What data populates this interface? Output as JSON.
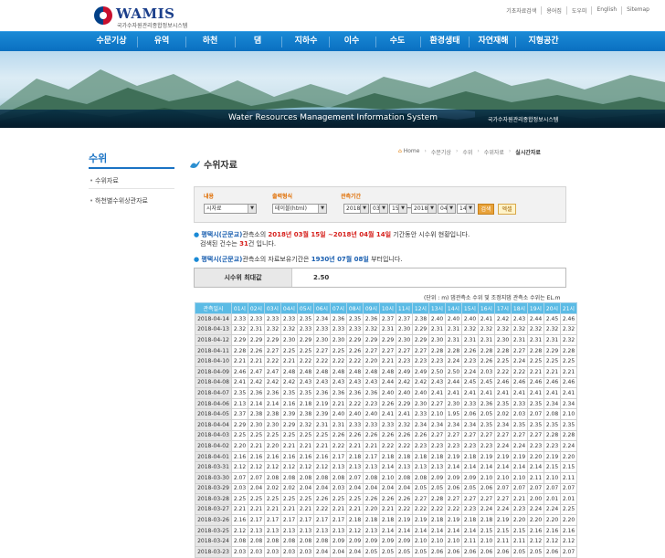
{
  "header": {
    "logo_name": "WAMIS",
    "logo_sub": "국가수자원관리종합정보시스템",
    "util_links": [
      "기초자료검색",
      "용어집",
      "도우미",
      "English",
      "Sitemap"
    ]
  },
  "gnb": [
    "수문기상",
    "유역",
    "하천",
    "댐",
    "지하수",
    "이수",
    "수도",
    "환경생태",
    "자연재해",
    "지형공간"
  ],
  "banner": {
    "title_en": "Water Resources Management Information System",
    "title_ko": "국가수자원관리종합정보시스템"
  },
  "lnb": {
    "title": "수위",
    "items": [
      "수위자료",
      "하천별수위상관자료"
    ]
  },
  "breadcrumb": [
    "Home",
    "수문기상",
    "수위",
    "수위자료",
    "실시간자료"
  ],
  "page_title": "수위자료",
  "search": {
    "label_type": "내용",
    "label_format": "출력형식",
    "label_period": "관측기간",
    "type_value": "시자료",
    "format_value": "테이블(html)",
    "start_year": "2018",
    "start_month": "03",
    "start_day": "15",
    "end_year": "2018",
    "end_month": "04",
    "end_day": "14",
    "search_button": "검색",
    "excel_button": "엑셀"
  },
  "notice1": {
    "station": "평택시(군문교)",
    "p1": "관측소의",
    "period": "2018년 03월 15일 ~2018년 04월 14일",
    "p2": "기간동안 시수위 현황입니다.",
    "p3": "검색된 건수는",
    "count": "31",
    "p4": "건 입니다."
  },
  "notice2": {
    "station": "평택시(군문교)",
    "p1": "관측소의 자료보유기간은",
    "since": "1930년 07월 08일",
    "p2": "부터입니다."
  },
  "max_level": {
    "label": "시수위 최대값",
    "value": "2.50"
  },
  "unit_note": "(단위 : m)  댐관측소 수위 및 조정지댐 관측소 수위는 EL.m",
  "table": {
    "headers": [
      "관측일시",
      "01시",
      "02시",
      "03시",
      "04시",
      "05시",
      "06시",
      "07시",
      "08시",
      "09시",
      "10시",
      "11시",
      "12시",
      "13시",
      "14시",
      "15시",
      "16시",
      "17시",
      "18시",
      "19시",
      "20시",
      "21시"
    ],
    "rows": [
      [
        "2018-04-14",
        "2.33",
        "2.33",
        "2.33",
        "2.33",
        "2.35",
        "2.34",
        "2.36",
        "2.35",
        "2.36",
        "2.37",
        "2.37",
        "2.38",
        "2.40",
        "2.40",
        "2.40",
        "2.41",
        "2.42",
        "2.43",
        "2.44",
        "2.45",
        "2.46"
      ],
      [
        "2018-04-13",
        "2.32",
        "2.31",
        "2.32",
        "2.32",
        "2.33",
        "2.33",
        "2.33",
        "2.33",
        "2.32",
        "2.31",
        "2.30",
        "2.29",
        "2.31",
        "2.31",
        "2.32",
        "2.32",
        "2.32",
        "2.32",
        "2.32",
        "2.32",
        "2.32"
      ],
      [
        "2018-04-12",
        "2.29",
        "2.29",
        "2.29",
        "2.30",
        "2.29",
        "2.30",
        "2.30",
        "2.29",
        "2.29",
        "2.29",
        "2.30",
        "2.29",
        "2.30",
        "2.31",
        "2.31",
        "2.31",
        "2.30",
        "2.31",
        "2.31",
        "2.31",
        "2.32"
      ],
      [
        "2018-04-11",
        "2.28",
        "2.26",
        "2.27",
        "2.25",
        "2.25",
        "2.27",
        "2.25",
        "2.26",
        "2.27",
        "2.27",
        "2.27",
        "2.27",
        "2.28",
        "2.28",
        "2.26",
        "2.28",
        "2.28",
        "2.27",
        "2.28",
        "2.29",
        "2.28"
      ],
      [
        "2018-04-10",
        "2.21",
        "2.21",
        "2.22",
        "2.21",
        "2.22",
        "2.22",
        "2.22",
        "2.22",
        "2.20",
        "2.21",
        "2.23",
        "2.23",
        "2.23",
        "2.24",
        "2.23",
        "2.26",
        "2.25",
        "2.24",
        "2.25",
        "2.25",
        "2.25"
      ],
      [
        "2018-04-09",
        "2.46",
        "2.47",
        "2.47",
        "2.48",
        "2.48",
        "2.48",
        "2.48",
        "2.48",
        "2.48",
        "2.48",
        "2.49",
        "2.49",
        "2.50",
        "2.50",
        "2.24",
        "2.03",
        "2.22",
        "2.22",
        "2.21",
        "2.21",
        "2.21"
      ],
      [
        "2018-04-08",
        "2.41",
        "2.42",
        "2.42",
        "2.42",
        "2.43",
        "2.43",
        "2.43",
        "2.43",
        "2.43",
        "2.44",
        "2.42",
        "2.42",
        "2.43",
        "2.44",
        "2.45",
        "2.45",
        "2.46",
        "2.46",
        "2.46",
        "2.46",
        "2.46"
      ],
      [
        "2018-04-07",
        "2.35",
        "2.36",
        "2.36",
        "2.35",
        "2.35",
        "2.36",
        "2.36",
        "2.36",
        "2.36",
        "2.40",
        "2.40",
        "2.40",
        "2.41",
        "2.41",
        "2.41",
        "2.41",
        "2.41",
        "2.41",
        "2.41",
        "2.41",
        "2.41"
      ],
      [
        "2018-04-06",
        "2.13",
        "2.14",
        "2.14",
        "2.16",
        "2.18",
        "2.19",
        "2.21",
        "2.22",
        "2.23",
        "2.26",
        "2.29",
        "2.30",
        "2.27",
        "2.30",
        "2.33",
        "2.36",
        "2.35",
        "2.33",
        "2.35",
        "2.34",
        "2.34"
      ],
      [
        "2018-04-05",
        "2.37",
        "2.38",
        "2.38",
        "2.39",
        "2.38",
        "2.39",
        "2.40",
        "2.40",
        "2.40",
        "2.41",
        "2.41",
        "2.33",
        "2.10",
        "1.95",
        "2.06",
        "2.05",
        "2.02",
        "2.03",
        "2.07",
        "2.08",
        "2.10"
      ],
      [
        "2018-04-04",
        "2.29",
        "2.30",
        "2.30",
        "2.29",
        "2.32",
        "2.31",
        "2.31",
        "2.33",
        "2.33",
        "2.33",
        "2.32",
        "2.34",
        "2.34",
        "2.34",
        "2.34",
        "2.35",
        "2.34",
        "2.35",
        "2.35",
        "2.35",
        "2.35"
      ],
      [
        "2018-04-03",
        "2.25",
        "2.25",
        "2.25",
        "2.25",
        "2.25",
        "2.25",
        "2.26",
        "2.26",
        "2.26",
        "2.26",
        "2.26",
        "2.26",
        "2.27",
        "2.27",
        "2.27",
        "2.27",
        "2.27",
        "2.27",
        "2.27",
        "2.28",
        "2.28"
      ],
      [
        "2018-04-02",
        "2.20",
        "2.21",
        "2.20",
        "2.21",
        "2.21",
        "2.21",
        "2.22",
        "2.21",
        "2.21",
        "2.22",
        "2.22",
        "2.23",
        "2.23",
        "2.23",
        "2.23",
        "2.23",
        "2.24",
        "2.24",
        "2.23",
        "2.23",
        "2.24"
      ],
      [
        "2018-04-01",
        "2.16",
        "2.16",
        "2.16",
        "2.16",
        "2.16",
        "2.16",
        "2.17",
        "2.18",
        "2.17",
        "2.18",
        "2.18",
        "2.18",
        "2.18",
        "2.19",
        "2.18",
        "2.19",
        "2.19",
        "2.19",
        "2.20",
        "2.19",
        "2.20"
      ],
      [
        "2018-03-31",
        "2.12",
        "2.12",
        "2.12",
        "2.12",
        "2.12",
        "2.12",
        "2.13",
        "2.13",
        "2.13",
        "2.14",
        "2.13",
        "2.13",
        "2.13",
        "2.14",
        "2.14",
        "2.14",
        "2.14",
        "2.14",
        "2.14",
        "2.15",
        "2.15"
      ],
      [
        "2018-03-30",
        "2.07",
        "2.07",
        "2.08",
        "2.08",
        "2.08",
        "2.08",
        "2.08",
        "2.07",
        "2.08",
        "2.10",
        "2.08",
        "2.08",
        "2.09",
        "2.09",
        "2.09",
        "2.10",
        "2.10",
        "2.10",
        "2.11",
        "2.10",
        "2.11"
      ],
      [
        "2018-03-29",
        "2.03",
        "2.04",
        "2.02",
        "2.02",
        "2.04",
        "2.04",
        "2.03",
        "2.04",
        "2.04",
        "2.04",
        "2.04",
        "2.05",
        "2.05",
        "2.06",
        "2.05",
        "2.06",
        "2.07",
        "2.07",
        "2.07",
        "2.07",
        "2.07"
      ],
      [
        "2018-03-28",
        "2.25",
        "2.25",
        "2.25",
        "2.25",
        "2.25",
        "2.26",
        "2.25",
        "2.25",
        "2.26",
        "2.26",
        "2.26",
        "2.27",
        "2.28",
        "2.27",
        "2.27",
        "2.27",
        "2.27",
        "2.21",
        "2.00",
        "2.01",
        "2.01"
      ],
      [
        "2018-03-27",
        "2.21",
        "2.21",
        "2.21",
        "2.21",
        "2.21",
        "2.22",
        "2.21",
        "2.21",
        "2.20",
        "2.21",
        "2.22",
        "2.22",
        "2.22",
        "2.22",
        "2.23",
        "2.24",
        "2.24",
        "2.23",
        "2.24",
        "2.24",
        "2.25"
      ],
      [
        "2018-03-26",
        "2.16",
        "2.17",
        "2.17",
        "2.17",
        "2.17",
        "2.17",
        "2.17",
        "2.18",
        "2.18",
        "2.18",
        "2.19",
        "2.19",
        "2.18",
        "2.19",
        "2.18",
        "2.18",
        "2.19",
        "2.20",
        "2.20",
        "2.20",
        "2.20"
      ],
      [
        "2018-03-25",
        "2.12",
        "2.13",
        "2.13",
        "2.13",
        "2.13",
        "2.13",
        "2.13",
        "2.12",
        "2.13",
        "2.14",
        "2.14",
        "2.14",
        "2.14",
        "2.14",
        "2.14",
        "2.15",
        "2.15",
        "2.15",
        "2.16",
        "2.16",
        "2.16"
      ],
      [
        "2018-03-24",
        "2.08",
        "2.08",
        "2.08",
        "2.08",
        "2.08",
        "2.08",
        "2.09",
        "2.09",
        "2.09",
        "2.09",
        "2.09",
        "2.10",
        "2.10",
        "2.10",
        "2.11",
        "2.10",
        "2.11",
        "2.11",
        "2.12",
        "2.12",
        "2.12"
      ],
      [
        "2018-03-23",
        "2.03",
        "2.03",
        "2.03",
        "2.03",
        "2.03",
        "2.04",
        "2.04",
        "2.04",
        "2.05",
        "2.05",
        "2.05",
        "2.05",
        "2.06",
        "2.06",
        "2.06",
        "2.06",
        "2.06",
        "2.05",
        "2.05",
        "2.06",
        "2.07"
      ]
    ]
  },
  "colors": {
    "gnb": "#0a6fc0",
    "accent": "#1a73c4",
    "table_header": "#5bbbe5",
    "highlight_red": "#d6201c",
    "label_orange": "#e06d00"
  }
}
